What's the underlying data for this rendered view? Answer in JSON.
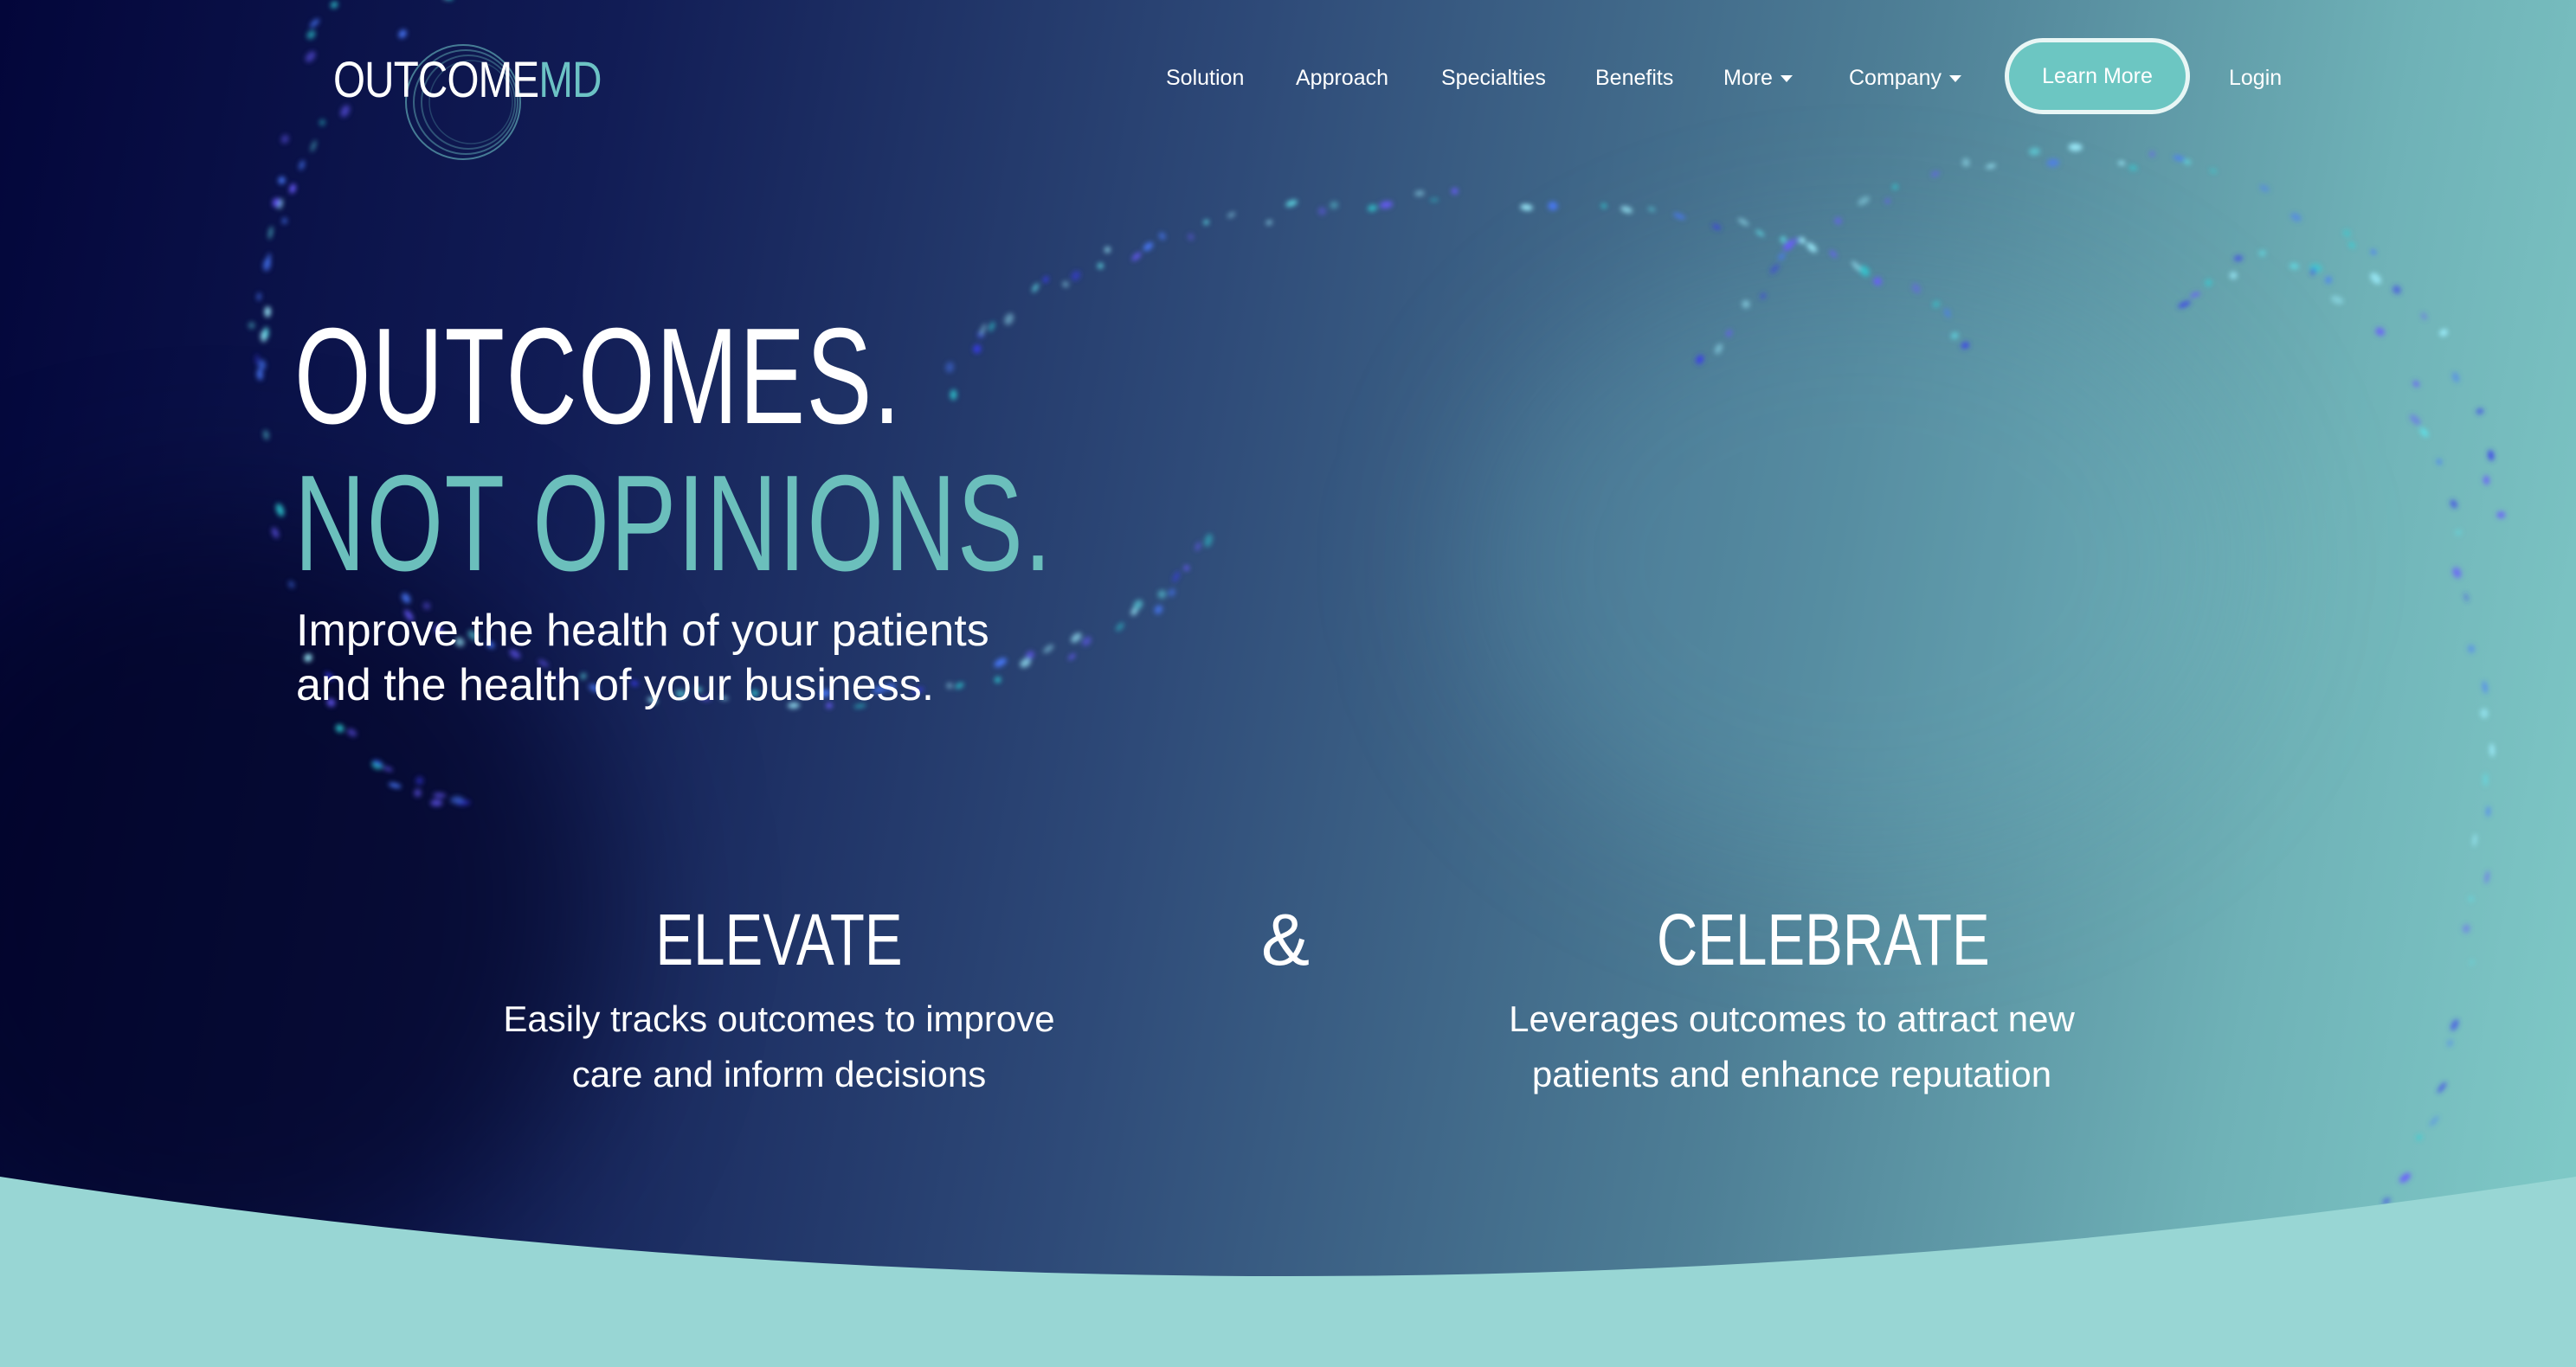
{
  "brand": {
    "name_primary": "OUTCOME",
    "name_accent": "MD"
  },
  "nav": {
    "items": [
      {
        "label": "Solution"
      },
      {
        "label": "Approach"
      },
      {
        "label": "Specialties"
      },
      {
        "label": "Benefits"
      },
      {
        "label": "More"
      },
      {
        "label": "Company"
      }
    ],
    "cta_label": "Learn More",
    "login_label": "Login"
  },
  "hero": {
    "headline_line1": "OUTCOMES.",
    "headline_line2": "NOT OPINIONS.",
    "subheadline_line1": "Improve the health of your patients",
    "subheadline_line2": "and the health of your business."
  },
  "features": {
    "connector": "&",
    "items": [
      {
        "title": "ELEVATE",
        "desc_line1": "Easily tracks outcomes to improve",
        "desc_line2": "care and inform decisions"
      },
      {
        "title": "CELEBRATE",
        "desc_line1": "Leverages outcomes to attract new",
        "desc_line2": "patients and enhance reputation"
      }
    ]
  },
  "colors": {
    "accent": "#6cc2c4",
    "dark": "#03063a",
    "button": "#6cc6c2",
    "wave": "#98d6d4"
  }
}
